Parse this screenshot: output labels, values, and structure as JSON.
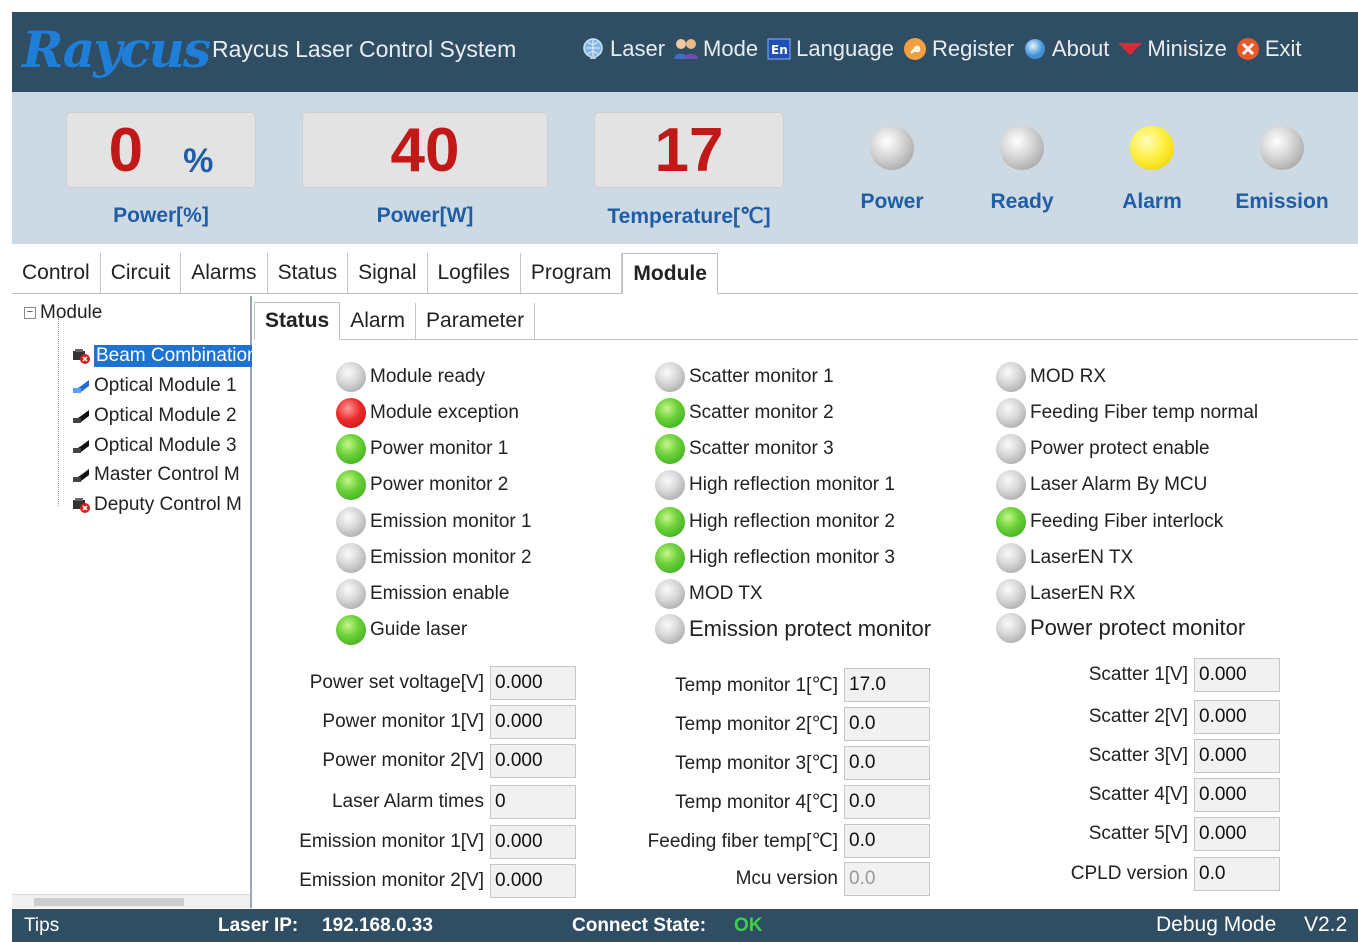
{
  "header": {
    "logo": "Raycus",
    "title": "Raycus Laser Control System",
    "menu": [
      {
        "label": "Laser",
        "icon": "laser-globe-icon"
      },
      {
        "label": "Mode",
        "icon": "users-mode-icon"
      },
      {
        "label": "Language",
        "icon": "language-en-icon"
      },
      {
        "label": "Register",
        "icon": "key-register-icon"
      },
      {
        "label": "About",
        "icon": "info-orb-icon"
      },
      {
        "label": "Minisize",
        "icon": "minimize-arrow-icon"
      },
      {
        "label": "Exit",
        "icon": "exit-close-icon"
      }
    ]
  },
  "readouts": {
    "power_pct": {
      "value": "0",
      "unit": "%",
      "label": "Power[%]"
    },
    "power_w": {
      "value": "40",
      "label": "Power[W]"
    },
    "temperature": {
      "value": "17",
      "label": "Temperature[℃]"
    }
  },
  "lamps": [
    {
      "label": "Power",
      "state": "off"
    },
    {
      "label": "Ready",
      "state": "off"
    },
    {
      "label": "Alarm",
      "state": "yellow"
    },
    {
      "label": "Emission",
      "state": "off"
    }
  ],
  "main_tabs": [
    "Control",
    "Circuit",
    "Alarms",
    "Status",
    "Signal",
    "Logfiles",
    "Program",
    "Module"
  ],
  "main_tab_active": "Module",
  "tree": {
    "root": "Module",
    "expander": "−",
    "items": [
      {
        "label": "Beam Combination",
        "selected": true,
        "icon": "module-error-icon"
      },
      {
        "label": "Optical Module 1",
        "icon": "module-blue-icon"
      },
      {
        "label": "Optical Module 2",
        "icon": "module-black-icon"
      },
      {
        "label": "Optical Module 3",
        "icon": "module-black-icon"
      },
      {
        "label": "Master Control M",
        "icon": "module-black-icon"
      },
      {
        "label": "Deputy Control M",
        "icon": "module-error-icon"
      }
    ]
  },
  "sub_tabs": [
    "Status",
    "Alarm",
    "Parameter"
  ],
  "sub_tab_active": "Status",
  "indicators": {
    "col1": [
      {
        "label": "Module ready",
        "state": "off"
      },
      {
        "label": "Module exception",
        "state": "red"
      },
      {
        "label": "Power monitor 1",
        "state": "green"
      },
      {
        "label": "Power monitor 2",
        "state": "green"
      },
      {
        "label": "Emission monitor 1",
        "state": "off"
      },
      {
        "label": "Emission monitor 2",
        "state": "off"
      },
      {
        "label": "Emission enable",
        "state": "off"
      },
      {
        "label": "Guide laser",
        "state": "green"
      }
    ],
    "col2": [
      {
        "label": "Scatter monitor 1",
        "state": "off"
      },
      {
        "label": "Scatter monitor 2",
        "state": "green"
      },
      {
        "label": "Scatter monitor 3",
        "state": "green"
      },
      {
        "label": "High reflection monitor 1",
        "state": "off"
      },
      {
        "label": "High reflection monitor 2",
        "state": "green"
      },
      {
        "label": "High reflection monitor 3",
        "state": "green"
      },
      {
        "label": "MOD TX",
        "state": "off"
      },
      {
        "label": "Emission protect monitor",
        "state": "off"
      }
    ],
    "col3": [
      {
        "label": "MOD RX",
        "state": "off"
      },
      {
        "label": "Feeding Fiber temp normal",
        "state": "off"
      },
      {
        "label": "Power protect enable",
        "state": "off"
      },
      {
        "label": "Laser Alarm By MCU",
        "state": "off"
      },
      {
        "label": "Feeding Fiber interlock",
        "state": "green"
      },
      {
        "label": "LaserEN TX",
        "state": "off"
      },
      {
        "label": "LaserEN RX",
        "state": "off"
      },
      {
        "label": "Power protect monitor",
        "state": "off"
      }
    ]
  },
  "fields": {
    "col1": [
      {
        "label": "Power set voltage[V]",
        "value": "0.000"
      },
      {
        "label": "Power monitor 1[V]",
        "value": "0.000"
      },
      {
        "label": "Power monitor 2[V]",
        "value": "0.000"
      },
      {
        "label": "Laser Alarm times",
        "value": "0"
      },
      {
        "label": "Emission monitor 1[V]",
        "value": "0.000"
      },
      {
        "label": "Emission monitor 2[V]",
        "value": "0.000"
      }
    ],
    "col2": [
      {
        "label": "Temp monitor 1[℃]",
        "value": "17.0"
      },
      {
        "label": "Temp monitor 2[℃]",
        "value": "0.0"
      },
      {
        "label": "Temp monitor 3[℃]",
        "value": "0.0"
      },
      {
        "label": "Temp monitor 4[℃]",
        "value": "0.0"
      },
      {
        "label": "Feeding fiber temp[℃]",
        "value": "0.0"
      },
      {
        "label": "Mcu version",
        "value": "0.0"
      }
    ],
    "col3": [
      {
        "label": "Scatter 1[V]",
        "value": "0.000"
      },
      {
        "label": "Scatter 2[V]",
        "value": "0.000"
      },
      {
        "label": "Scatter 3[V]",
        "value": "0.000"
      },
      {
        "label": "Scatter 4[V]",
        "value": "0.000"
      },
      {
        "label": "Scatter 5[V]",
        "value": "0.000"
      },
      {
        "label": "CPLD version",
        "value": "0.0"
      }
    ]
  },
  "statusbar": {
    "tips": "Tips",
    "ip_label": "Laser IP:",
    "ip_value": "192.168.0.33",
    "connect_label": "Connect State:",
    "connect_value": "OK",
    "mode": "Debug Mode",
    "version": "V2.2"
  },
  "colors": {
    "header_bg": "#2f4d63",
    "band_bg": "#cdd9e3",
    "readout_red": "#c11818",
    "label_blue": "#1f5ea6",
    "ok_green": "#39d146"
  }
}
